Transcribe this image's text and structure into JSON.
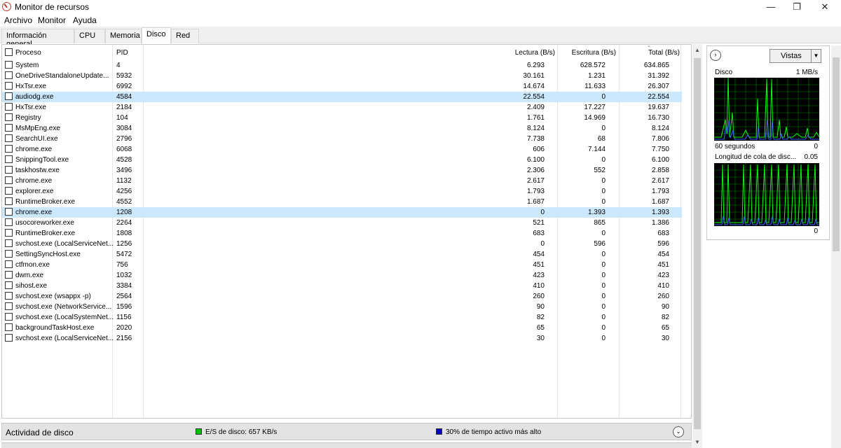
{
  "window": {
    "title": "Monitor de recursos",
    "min": "—",
    "max": "❐",
    "close": "✕"
  },
  "menu": [
    "Archivo",
    "Monitor",
    "Ayuda"
  ],
  "tabs": [
    "Información general",
    "CPU",
    "Memoria",
    "Disco",
    "Red"
  ],
  "active_tab": "Disco",
  "table": {
    "headers": {
      "process": "Proceso",
      "pid": "PID",
      "read": "Lectura (B/s)",
      "write": "Escritura (B/s)",
      "total": "Total (B/s)"
    },
    "rows": [
      {
        "name": "System",
        "pid": "4",
        "read": "6.293",
        "write": "628.572",
        "total": "634.865",
        "selected": false
      },
      {
        "name": "OneDriveStandaloneUpdate...",
        "pid": "5932",
        "read": "30.161",
        "write": "1.231",
        "total": "31.392",
        "selected": false
      },
      {
        "name": "HxTsr.exe",
        "pid": "6992",
        "read": "14.674",
        "write": "11.633",
        "total": "26.307",
        "selected": false
      },
      {
        "name": "audiodg.exe",
        "pid": "4584",
        "read": "22.554",
        "write": "0",
        "total": "22.554",
        "selected": true
      },
      {
        "name": "HxTsr.exe",
        "pid": "2184",
        "read": "2.409",
        "write": "17.227",
        "total": "19.637",
        "selected": false
      },
      {
        "name": "Registry",
        "pid": "104",
        "read": "1.761",
        "write": "14.969",
        "total": "16.730",
        "selected": false
      },
      {
        "name": "MsMpEng.exe",
        "pid": "3084",
        "read": "8.124",
        "write": "0",
        "total": "8.124",
        "selected": false
      },
      {
        "name": "SearchUI.exe",
        "pid": "2796",
        "read": "7.738",
        "write": "68",
        "total": "7.806",
        "selected": false
      },
      {
        "name": "chrome.exe",
        "pid": "6068",
        "read": "606",
        "write": "7.144",
        "total": "7.750",
        "selected": false
      },
      {
        "name": "SnippingTool.exe",
        "pid": "4528",
        "read": "6.100",
        "write": "0",
        "total": "6.100",
        "selected": false
      },
      {
        "name": "taskhostw.exe",
        "pid": "3496",
        "read": "2.306",
        "write": "552",
        "total": "2.858",
        "selected": false
      },
      {
        "name": "chrome.exe",
        "pid": "1132",
        "read": "2.617",
        "write": "0",
        "total": "2.617",
        "selected": false
      },
      {
        "name": "explorer.exe",
        "pid": "4256",
        "read": "1.793",
        "write": "0",
        "total": "1.793",
        "selected": false
      },
      {
        "name": "RuntimeBroker.exe",
        "pid": "4552",
        "read": "1.687",
        "write": "0",
        "total": "1.687",
        "selected": false
      },
      {
        "name": "chrome.exe",
        "pid": "1208",
        "read": "0",
        "write": "1.393",
        "total": "1.393",
        "selected": true
      },
      {
        "name": "usocoreworker.exe",
        "pid": "2264",
        "read": "521",
        "write": "865",
        "total": "1.386",
        "selected": false
      },
      {
        "name": "RuntimeBroker.exe",
        "pid": "1808",
        "read": "683",
        "write": "0",
        "total": "683",
        "selected": false
      },
      {
        "name": "svchost.exe (LocalServiceNet...",
        "pid": "1256",
        "read": "0",
        "write": "596",
        "total": "596",
        "selected": false
      },
      {
        "name": "SettingSyncHost.exe",
        "pid": "5472",
        "read": "454",
        "write": "0",
        "total": "454",
        "selected": false
      },
      {
        "name": "ctfmon.exe",
        "pid": "756",
        "read": "451",
        "write": "0",
        "total": "451",
        "selected": false
      },
      {
        "name": "dwm.exe",
        "pid": "1032",
        "read": "423",
        "write": "0",
        "total": "423",
        "selected": false
      },
      {
        "name": "sihost.exe",
        "pid": "3384",
        "read": "410",
        "write": "0",
        "total": "410",
        "selected": false
      },
      {
        "name": "svchost.exe (wsappx -p)",
        "pid": "2564",
        "read": "260",
        "write": "0",
        "total": "260",
        "selected": false
      },
      {
        "name": "svchost.exe (NetworkService...",
        "pid": "1596",
        "read": "90",
        "write": "0",
        "total": "90",
        "selected": false
      },
      {
        "name": "svchost.exe (LocalSystemNet...",
        "pid": "1156",
        "read": "82",
        "write": "0",
        "total": "82",
        "selected": false
      },
      {
        "name": "backgroundTaskHost.exe",
        "pid": "2020",
        "read": "65",
        "write": "0",
        "total": "65",
        "selected": false
      },
      {
        "name": "svchost.exe (LocalServiceNet...",
        "pid": "2156",
        "read": "30",
        "write": "0",
        "total": "30",
        "selected": false
      }
    ]
  },
  "activity": {
    "title": "Actividad de disco",
    "io_label": "E/S de disco: 657 KB/s",
    "io_color": "#00c000",
    "active_label": "30% de tiempo activo más alto",
    "active_color": "#0000c0"
  },
  "right_panel": {
    "views_button": "Vistas",
    "disk_graph": {
      "label": "Disco",
      "max": "1 MB/s",
      "time": "60 segundos",
      "min": "0"
    },
    "queue_graph": {
      "label": "Longitud de cola de disc...",
      "max": "0.05",
      "min": "0"
    },
    "graph_colors": {
      "background": "#000000",
      "grid": "#008000",
      "activity": "#00ff00",
      "io": "#4060ff"
    }
  }
}
